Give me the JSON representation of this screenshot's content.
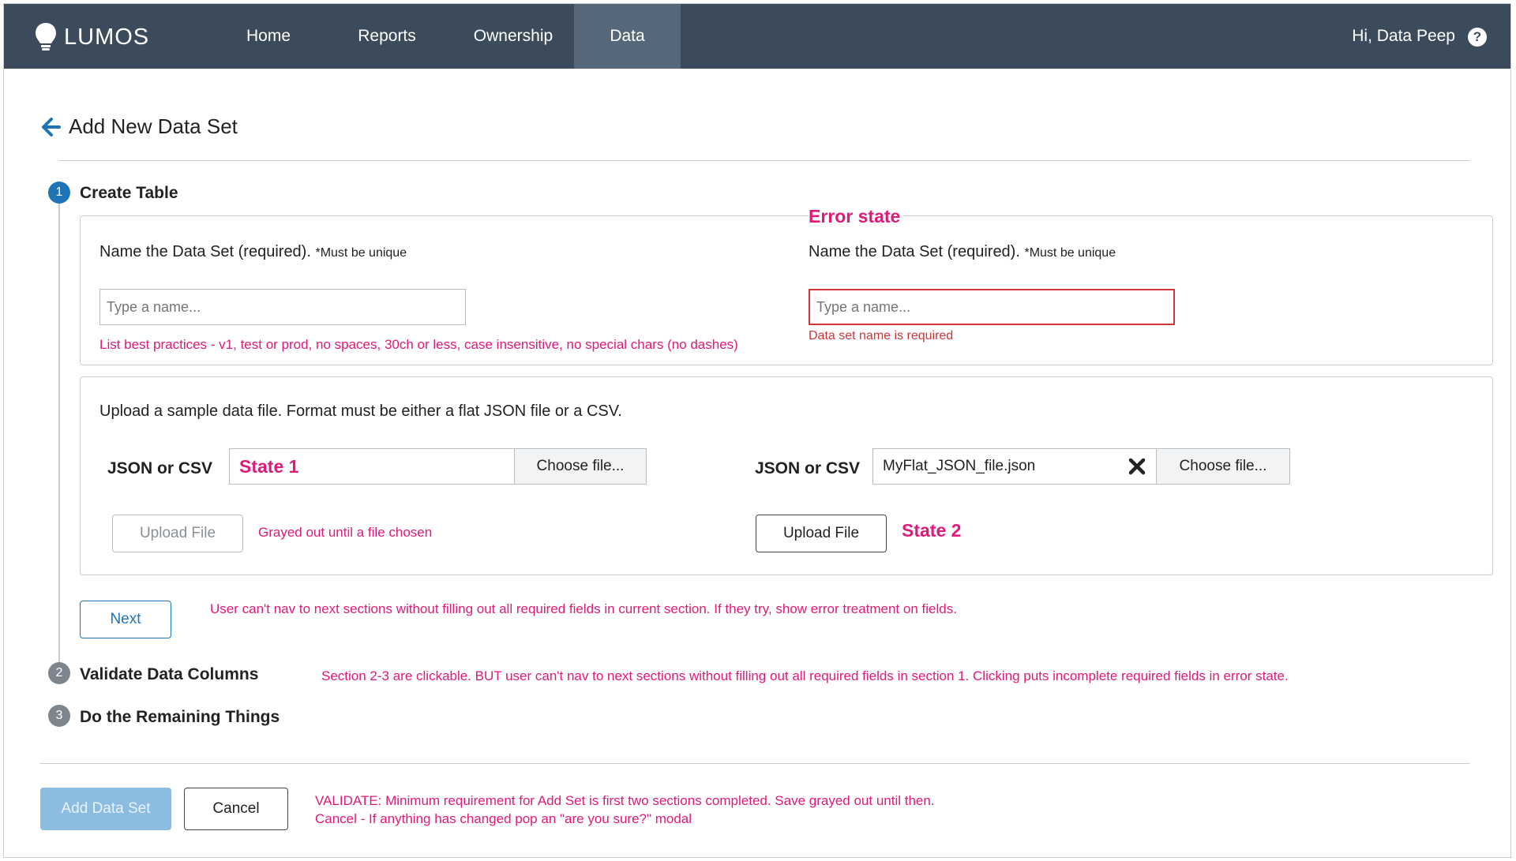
{
  "nav": {
    "brand": "LUMOS",
    "items": [
      "Home",
      "Reports",
      "Ownership",
      "Data"
    ],
    "active": "Data",
    "greeting": "Hi, Data Peep",
    "help_glyph": "?"
  },
  "page": {
    "title": "Add New Data Set"
  },
  "steps": [
    {
      "num": "1",
      "title": "Create Table",
      "state": "active"
    },
    {
      "num": "2",
      "title": "Validate Data Columns",
      "state": "inactive"
    },
    {
      "num": "3",
      "title": "Do the Remaining Things",
      "state": "inactive"
    }
  ],
  "name_section": {
    "label": "Name the Data Set (required).",
    "label_note": "*Must be unique",
    "placeholder": "Type a name...",
    "best_practices": "List best practices - v1, test or prod, no spaces, 30ch or less, case insensitive, no special chars (no dashes)",
    "error_state_title": "Error state",
    "error_label": "Name the Data Set (required).",
    "error_label_note": "*Must be unique",
    "error_placeholder": "Type a name...",
    "error_message": "Data set name is required"
  },
  "upload_section": {
    "instruction": "Upload a sample data file. Format must be either a flat JSON file or a CSV.",
    "state1": {
      "field_label": "JSON or CSV",
      "annotation": "State 1",
      "choose_label": "Choose file...",
      "upload_label": "Upload File",
      "note": "Grayed out until a file chosen"
    },
    "state2": {
      "field_label": "JSON or CSV",
      "file_name": "MyFlat_JSON_file.json",
      "choose_label": "Choose file...",
      "upload_label": "Upload File",
      "annotation": "State 2"
    }
  },
  "next": {
    "label": "Next",
    "note": "User can't nav to next sections without filling out all required fields in current section. If they try, show error treatment on fields."
  },
  "section_note": "Section 2-3 are clickable. BUT user can't nav to next sections without filling out all required fields in section 1. Clicking puts incomplete required fields in error state.",
  "footer": {
    "add_label": "Add Data Set",
    "cancel_label": "Cancel",
    "validate_note": "VALIDATE: Minimum requirement for Add Set is first two sections completed. Save grayed out until then.",
    "cancel_note": "Cancel - If anything has changed pop an \"are you sure?\" modal"
  },
  "colors": {
    "nav_bg": "#3c4b5c",
    "nav_active": "#566779",
    "accent": "#1f74b5",
    "annotation": "#e0197a",
    "error": "#d0353a"
  }
}
